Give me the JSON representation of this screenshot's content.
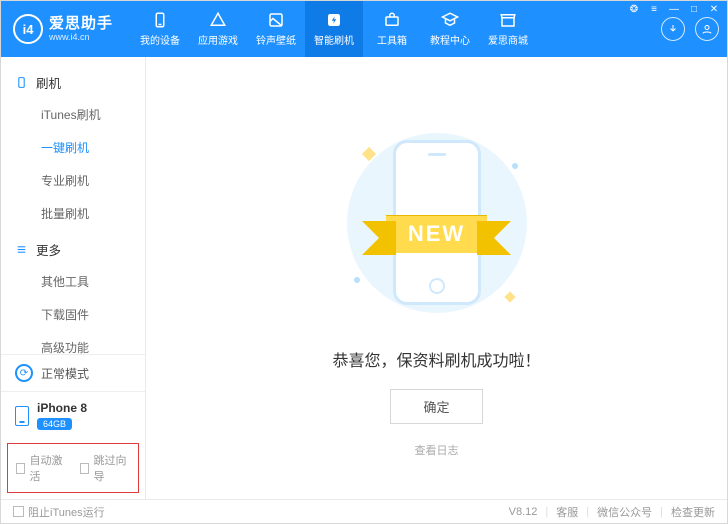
{
  "brand": {
    "name": "爱思助手",
    "site": "www.i4.cn",
    "logo_text": "i4"
  },
  "nav": {
    "items": [
      {
        "label": "我的设备"
      },
      {
        "label": "应用游戏"
      },
      {
        "label": "铃声壁纸"
      },
      {
        "label": "智能刷机"
      },
      {
        "label": "工具箱"
      },
      {
        "label": "教程中心"
      },
      {
        "label": "爱思商城"
      }
    ],
    "active_index": 3
  },
  "sidebar": {
    "groups": [
      {
        "title": "刷机",
        "items": [
          "iTunes刷机",
          "一键刷机",
          "专业刷机",
          "批量刷机"
        ],
        "active_index": 1
      },
      {
        "title": "更多",
        "items": [
          "其他工具",
          "下载固件",
          "高级功能"
        ],
        "active_index": -1
      }
    ],
    "mode": "正常模式",
    "device": {
      "name": "iPhone 8",
      "storage": "64GB"
    },
    "options": {
      "auto_activate": "自动激活",
      "skip_wizard": "跳过向导"
    }
  },
  "main": {
    "ribbon": "NEW",
    "success": "恭喜您，保资料刷机成功啦！",
    "confirm": "确定",
    "view_log": "查看日志"
  },
  "footer": {
    "block_itunes": "阻止iTunes运行",
    "version": "V8.12",
    "support": "客服",
    "wechat": "微信公众号",
    "update": "检查更新"
  }
}
